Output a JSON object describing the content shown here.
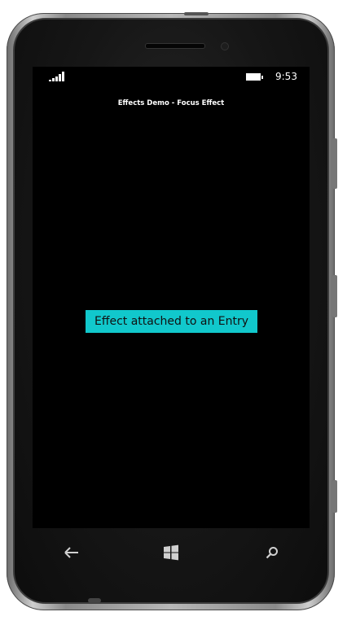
{
  "status_bar": {
    "time": "9:53",
    "signal_icon": "signal-bars-icon",
    "battery_icon": "battery-icon",
    "battery_level": 1.0
  },
  "page": {
    "title": "Effects Demo - Focus Effect"
  },
  "entry": {
    "value": "Effect attached to an Entry",
    "background_color": "#11c8cc"
  },
  "nav_bar": {
    "back_icon": "back-arrow-icon",
    "start_icon": "windows-logo-icon",
    "search_icon": "search-icon"
  },
  "colors": {
    "screen_background": "#000000",
    "text": "#ffffff"
  }
}
